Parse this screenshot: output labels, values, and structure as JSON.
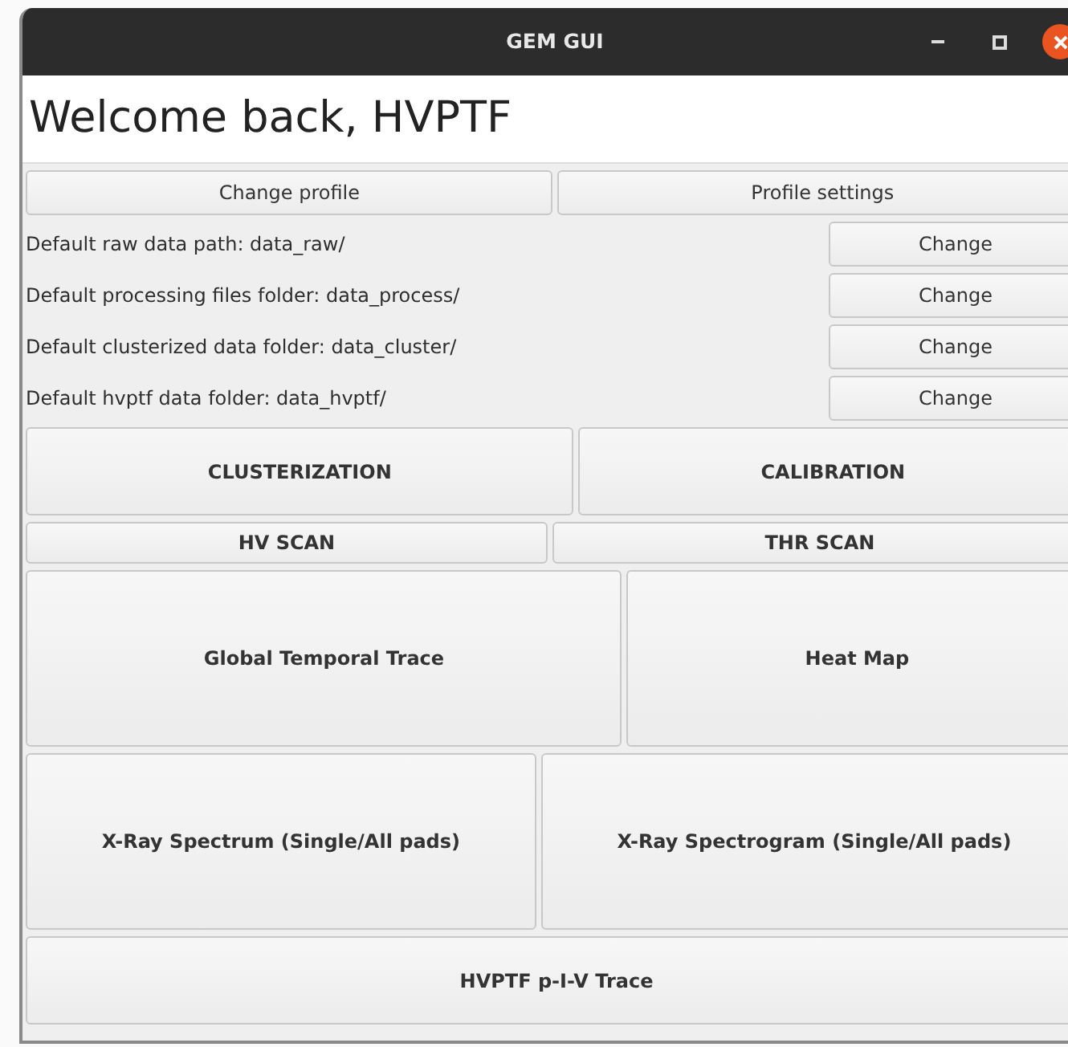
{
  "window": {
    "title": "GEM GUI"
  },
  "welcome": "Welcome back, HVPTF",
  "profile_buttons": [
    "Change profile",
    "Profile settings"
  ],
  "paths": [
    {
      "label": "Default raw data path: data_raw/",
      "button": "Change"
    },
    {
      "label": "Default processing files folder: data_process/",
      "button": "Change"
    },
    {
      "label": "Default clusterized data folder: data_cluster/",
      "button": "Change"
    },
    {
      "label": "Default hvptf data folder: data_hvptf/",
      "button": "Change"
    }
  ],
  "analysis_rows": [
    [
      "CLUSTERIZATION",
      "CALIBRATION"
    ],
    [
      "HV SCAN",
      "THR SCAN"
    ],
    [
      "Global Temporal Trace",
      "Heat Map"
    ],
    [
      "X-Ray Spectrum (Single/All pads)",
      "X-Ray Spectrogram (Single/All pads)"
    ],
    [
      "HVPTF p-I-V Trace"
    ]
  ]
}
